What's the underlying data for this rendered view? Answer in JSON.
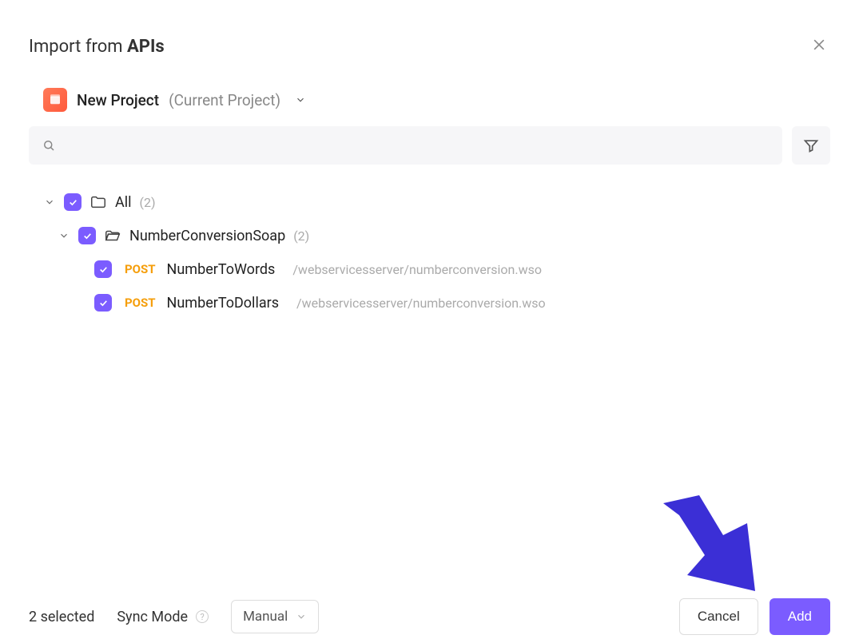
{
  "dialog": {
    "title_prefix": "Import from ",
    "title_bold": "APIs"
  },
  "project": {
    "name": "New Project",
    "current_suffix": "(Current Project)"
  },
  "tree": {
    "root": {
      "label": "All",
      "count": "(2)"
    },
    "group": {
      "label": "NumberConversionSoap",
      "count": "(2)"
    },
    "items": [
      {
        "method": "POST",
        "name": "NumberToWords",
        "path": "/webservicesserver/numberconversion.wso"
      },
      {
        "method": "POST",
        "name": "NumberToDollars",
        "path": "/webservicesserver/numberconversion.wso"
      }
    ]
  },
  "footer": {
    "selected_text": "2 selected",
    "sync_label": "Sync Mode",
    "sync_value": "Manual",
    "cancel": "Cancel",
    "add": "Add"
  }
}
